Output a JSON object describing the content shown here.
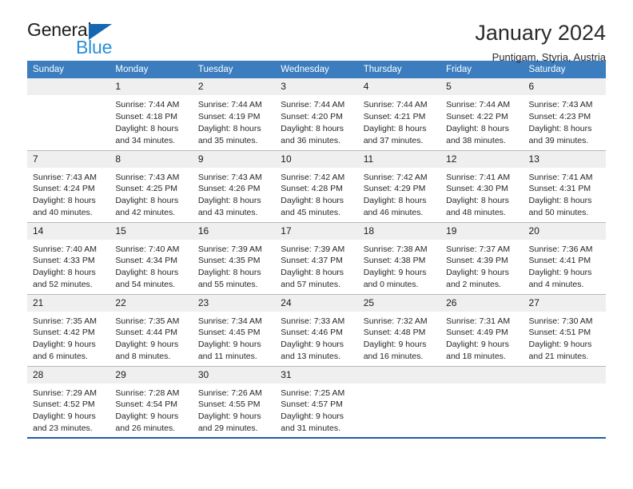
{
  "brand": {
    "name_part1": "General",
    "name_part2": "Blue",
    "triangle_color": "#1567b2",
    "blue_text_color": "#2a8fd6"
  },
  "header": {
    "title": "January 2024",
    "subtitle": "Puntigam, Styria, Austria"
  },
  "theme": {
    "header_row_bg": "#3b7dbf",
    "header_row_text": "#ffffff",
    "daynum_bg": "#efefef",
    "row_divider": "#b9b9b9",
    "table_bottom_border": "#1e5fa3"
  },
  "weekday_headers": [
    "Sunday",
    "Monday",
    "Tuesday",
    "Wednesday",
    "Thursday",
    "Friday",
    "Saturday"
  ],
  "weeks": [
    [
      {
        "day": "",
        "lines": []
      },
      {
        "day": "1",
        "lines": [
          "Sunrise: 7:44 AM",
          "Sunset: 4:18 PM",
          "Daylight: 8 hours",
          "and 34 minutes."
        ]
      },
      {
        "day": "2",
        "lines": [
          "Sunrise: 7:44 AM",
          "Sunset: 4:19 PM",
          "Daylight: 8 hours",
          "and 35 minutes."
        ]
      },
      {
        "day": "3",
        "lines": [
          "Sunrise: 7:44 AM",
          "Sunset: 4:20 PM",
          "Daylight: 8 hours",
          "and 36 minutes."
        ]
      },
      {
        "day": "4",
        "lines": [
          "Sunrise: 7:44 AM",
          "Sunset: 4:21 PM",
          "Daylight: 8 hours",
          "and 37 minutes."
        ]
      },
      {
        "day": "5",
        "lines": [
          "Sunrise: 7:44 AM",
          "Sunset: 4:22 PM",
          "Daylight: 8 hours",
          "and 38 minutes."
        ]
      },
      {
        "day": "6",
        "lines": [
          "Sunrise: 7:43 AM",
          "Sunset: 4:23 PM",
          "Daylight: 8 hours",
          "and 39 minutes."
        ]
      }
    ],
    [
      {
        "day": "7",
        "lines": [
          "Sunrise: 7:43 AM",
          "Sunset: 4:24 PM",
          "Daylight: 8 hours",
          "and 40 minutes."
        ]
      },
      {
        "day": "8",
        "lines": [
          "Sunrise: 7:43 AM",
          "Sunset: 4:25 PM",
          "Daylight: 8 hours",
          "and 42 minutes."
        ]
      },
      {
        "day": "9",
        "lines": [
          "Sunrise: 7:43 AM",
          "Sunset: 4:26 PM",
          "Daylight: 8 hours",
          "and 43 minutes."
        ]
      },
      {
        "day": "10",
        "lines": [
          "Sunrise: 7:42 AM",
          "Sunset: 4:28 PM",
          "Daylight: 8 hours",
          "and 45 minutes."
        ]
      },
      {
        "day": "11",
        "lines": [
          "Sunrise: 7:42 AM",
          "Sunset: 4:29 PM",
          "Daylight: 8 hours",
          "and 46 minutes."
        ]
      },
      {
        "day": "12",
        "lines": [
          "Sunrise: 7:41 AM",
          "Sunset: 4:30 PM",
          "Daylight: 8 hours",
          "and 48 minutes."
        ]
      },
      {
        "day": "13",
        "lines": [
          "Sunrise: 7:41 AM",
          "Sunset: 4:31 PM",
          "Daylight: 8 hours",
          "and 50 minutes."
        ]
      }
    ],
    [
      {
        "day": "14",
        "lines": [
          "Sunrise: 7:40 AM",
          "Sunset: 4:33 PM",
          "Daylight: 8 hours",
          "and 52 minutes."
        ]
      },
      {
        "day": "15",
        "lines": [
          "Sunrise: 7:40 AM",
          "Sunset: 4:34 PM",
          "Daylight: 8 hours",
          "and 54 minutes."
        ]
      },
      {
        "day": "16",
        "lines": [
          "Sunrise: 7:39 AM",
          "Sunset: 4:35 PM",
          "Daylight: 8 hours",
          "and 55 minutes."
        ]
      },
      {
        "day": "17",
        "lines": [
          "Sunrise: 7:39 AM",
          "Sunset: 4:37 PM",
          "Daylight: 8 hours",
          "and 57 minutes."
        ]
      },
      {
        "day": "18",
        "lines": [
          "Sunrise: 7:38 AM",
          "Sunset: 4:38 PM",
          "Daylight: 9 hours",
          "and 0 minutes."
        ]
      },
      {
        "day": "19",
        "lines": [
          "Sunrise: 7:37 AM",
          "Sunset: 4:39 PM",
          "Daylight: 9 hours",
          "and 2 minutes."
        ]
      },
      {
        "day": "20",
        "lines": [
          "Sunrise: 7:36 AM",
          "Sunset: 4:41 PM",
          "Daylight: 9 hours",
          "and 4 minutes."
        ]
      }
    ],
    [
      {
        "day": "21",
        "lines": [
          "Sunrise: 7:35 AM",
          "Sunset: 4:42 PM",
          "Daylight: 9 hours",
          "and 6 minutes."
        ]
      },
      {
        "day": "22",
        "lines": [
          "Sunrise: 7:35 AM",
          "Sunset: 4:44 PM",
          "Daylight: 9 hours",
          "and 8 minutes."
        ]
      },
      {
        "day": "23",
        "lines": [
          "Sunrise: 7:34 AM",
          "Sunset: 4:45 PM",
          "Daylight: 9 hours",
          "and 11 minutes."
        ]
      },
      {
        "day": "24",
        "lines": [
          "Sunrise: 7:33 AM",
          "Sunset: 4:46 PM",
          "Daylight: 9 hours",
          "and 13 minutes."
        ]
      },
      {
        "day": "25",
        "lines": [
          "Sunrise: 7:32 AM",
          "Sunset: 4:48 PM",
          "Daylight: 9 hours",
          "and 16 minutes."
        ]
      },
      {
        "day": "26",
        "lines": [
          "Sunrise: 7:31 AM",
          "Sunset: 4:49 PM",
          "Daylight: 9 hours",
          "and 18 minutes."
        ]
      },
      {
        "day": "27",
        "lines": [
          "Sunrise: 7:30 AM",
          "Sunset: 4:51 PM",
          "Daylight: 9 hours",
          "and 21 minutes."
        ]
      }
    ],
    [
      {
        "day": "28",
        "lines": [
          "Sunrise: 7:29 AM",
          "Sunset: 4:52 PM",
          "Daylight: 9 hours",
          "and 23 minutes."
        ]
      },
      {
        "day": "29",
        "lines": [
          "Sunrise: 7:28 AM",
          "Sunset: 4:54 PM",
          "Daylight: 9 hours",
          "and 26 minutes."
        ]
      },
      {
        "day": "30",
        "lines": [
          "Sunrise: 7:26 AM",
          "Sunset: 4:55 PM",
          "Daylight: 9 hours",
          "and 29 minutes."
        ]
      },
      {
        "day": "31",
        "lines": [
          "Sunrise: 7:25 AM",
          "Sunset: 4:57 PM",
          "Daylight: 9 hours",
          "and 31 minutes."
        ]
      },
      {
        "day": "",
        "lines": []
      },
      {
        "day": "",
        "lines": []
      },
      {
        "day": "",
        "lines": []
      }
    ]
  ]
}
